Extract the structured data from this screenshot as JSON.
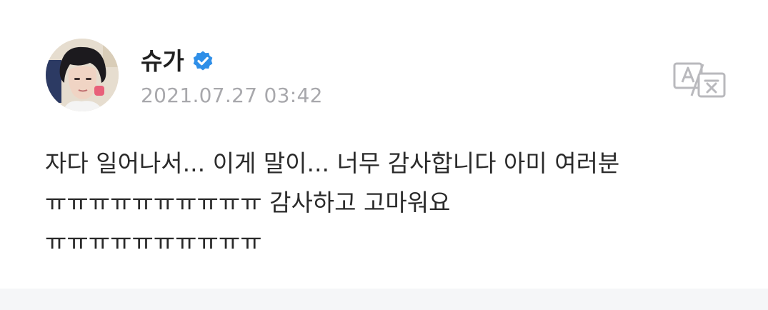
{
  "post": {
    "author": "슈가",
    "timestamp": "2021.07.27 03:42",
    "lines": [
      "자다 일어나서... 이게 말이... 너무 감사합니다 아미 여러분",
      "ㅠㅠㅠㅠㅠㅠㅠㅠㅠㅠ 감사하고 고마워요",
      "ㅠㅠㅠㅠㅠㅠㅠㅠㅠㅠ"
    ]
  },
  "icons": {
    "verified": "verified-badge-icon",
    "translate": "translate-icon"
  },
  "colors": {
    "verified_blue": "#2f8fe8",
    "timestamp_gray": "#a8a8ac",
    "icon_gray": "#b9b9bd"
  }
}
